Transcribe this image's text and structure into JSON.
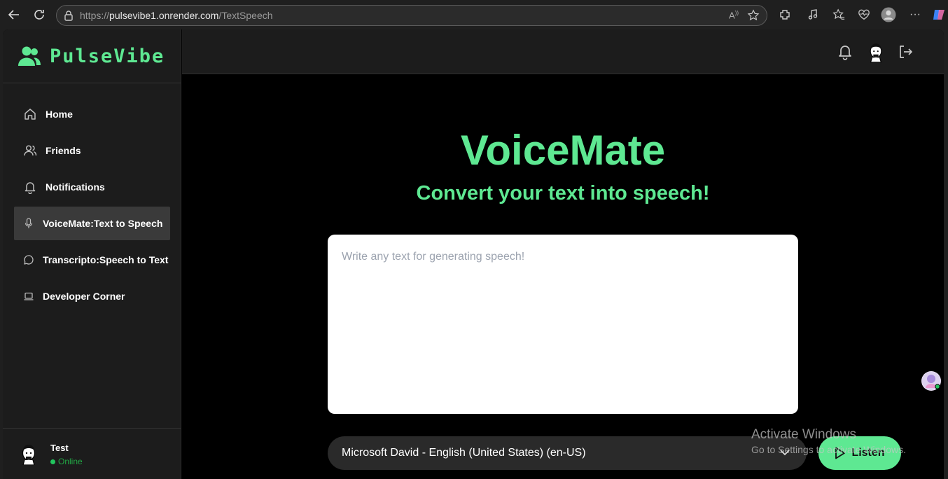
{
  "browser": {
    "url_prefix": "https://",
    "url_host": "pulsevibe1.onrender.com",
    "url_path": "/TextSpeech"
  },
  "app": {
    "logo_text": "PulseVibe",
    "accent_color": "#5ee892"
  },
  "sidebar": {
    "items": [
      {
        "label": "Home",
        "icon": "home-icon"
      },
      {
        "label": "Friends",
        "icon": "users-icon"
      },
      {
        "label": "Notifications",
        "icon": "bell-icon"
      },
      {
        "label": "VoiceMate:Text to Speech",
        "icon": "mic-icon",
        "active": true
      },
      {
        "label": "Transcripto:Speech to Text",
        "icon": "chat-icon"
      },
      {
        "label": "Developer Corner",
        "icon": "laptop-icon"
      }
    ]
  },
  "user": {
    "name": "Test",
    "status": "Online"
  },
  "main": {
    "title": "VoiceMate",
    "subtitle": "Convert your text into speech!",
    "textarea_placeholder": "Write any text for generating speech!",
    "voice_selected": "Microsoft David - English (United States) (en-US)",
    "listen_label": "Listen"
  },
  "watermark": {
    "line1": "Activate Windows",
    "line2": "Go to Settings to activate Windows."
  }
}
